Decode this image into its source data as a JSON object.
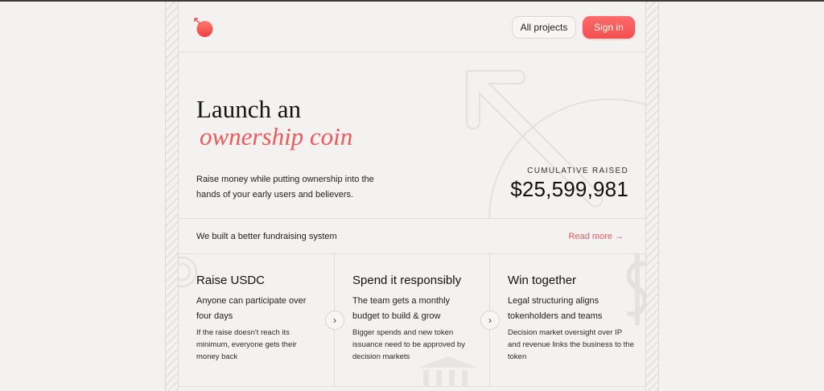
{
  "header": {
    "logo_icon": "arrow-coin-logo",
    "all_projects_label": "All projects",
    "sign_in_label": "Sign in"
  },
  "hero": {
    "title_line1": "Launch an",
    "title_line2": "ownership coin",
    "description": "Raise money while putting ownership into the hands of your early users and believers.",
    "raised_label": "CUMULATIVE RAISED",
    "raised_value": "$25,599,981"
  },
  "banner": {
    "text": "We built a better fundraising system",
    "read_more": "Read more →"
  },
  "features": [
    {
      "title": "Raise USDC",
      "subtitle": "Anyone can participate over four days",
      "description": "If the raise doesn't reach its minimum, everyone gets their money back"
    },
    {
      "title": "Spend it responsibly",
      "subtitle": "The team gets a monthly budget to build & grow",
      "description": "Bigger spends and new token issuance need to be approved by decision markets"
    },
    {
      "title": "Win together",
      "subtitle": "Legal structuring aligns tokenholders and teams",
      "description": "Decision market oversight over IP and revenue links the business to the token"
    }
  ],
  "arrows": {
    "next": "›"
  },
  "colors": {
    "accent": "#f0585a",
    "background": "#f3f2f1"
  }
}
